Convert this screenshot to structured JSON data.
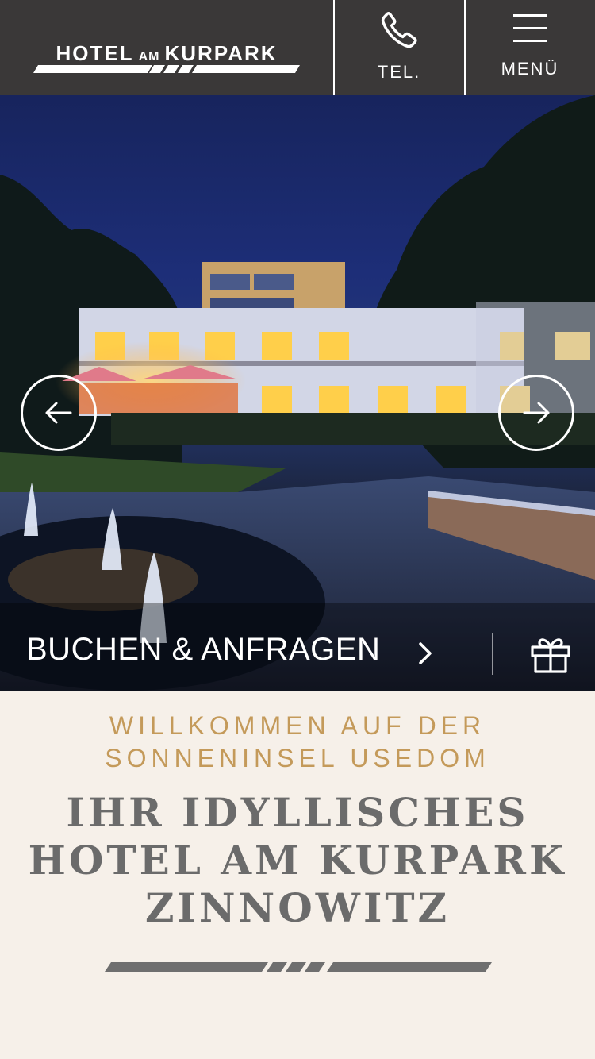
{
  "header": {
    "logo": {
      "part1": "HOTEL",
      "part2": "AM",
      "part3": "KURPARK"
    },
    "phone_label": "TEL.",
    "menu_label": "MENÜ",
    "icons": {
      "phone": "phone-icon",
      "menu": "hamburger-menu-icon"
    }
  },
  "hero": {
    "prev_icon": "arrow-left-icon",
    "next_icon": "arrow-right-icon",
    "book_label": "BUCHEN & ANFRAGEN",
    "book_icon": "chevron-right-icon",
    "gift_icon": "gift-icon"
  },
  "welcome": {
    "kicker_line1": "WILLKOMMEN AUF DER",
    "kicker_line2": "SONNENINSEL USEDOM",
    "headline_line1": "IHR IDYLLISCHES",
    "headline_line2": "HOTEL AM KURPARK",
    "headline_line3": "ZINNOWITZ"
  },
  "colors": {
    "header_bg": "#3a3838",
    "section_bg": "#f6f0e9",
    "accent_gold": "#c49a5a",
    "headline_gray": "#6b6b6b"
  }
}
